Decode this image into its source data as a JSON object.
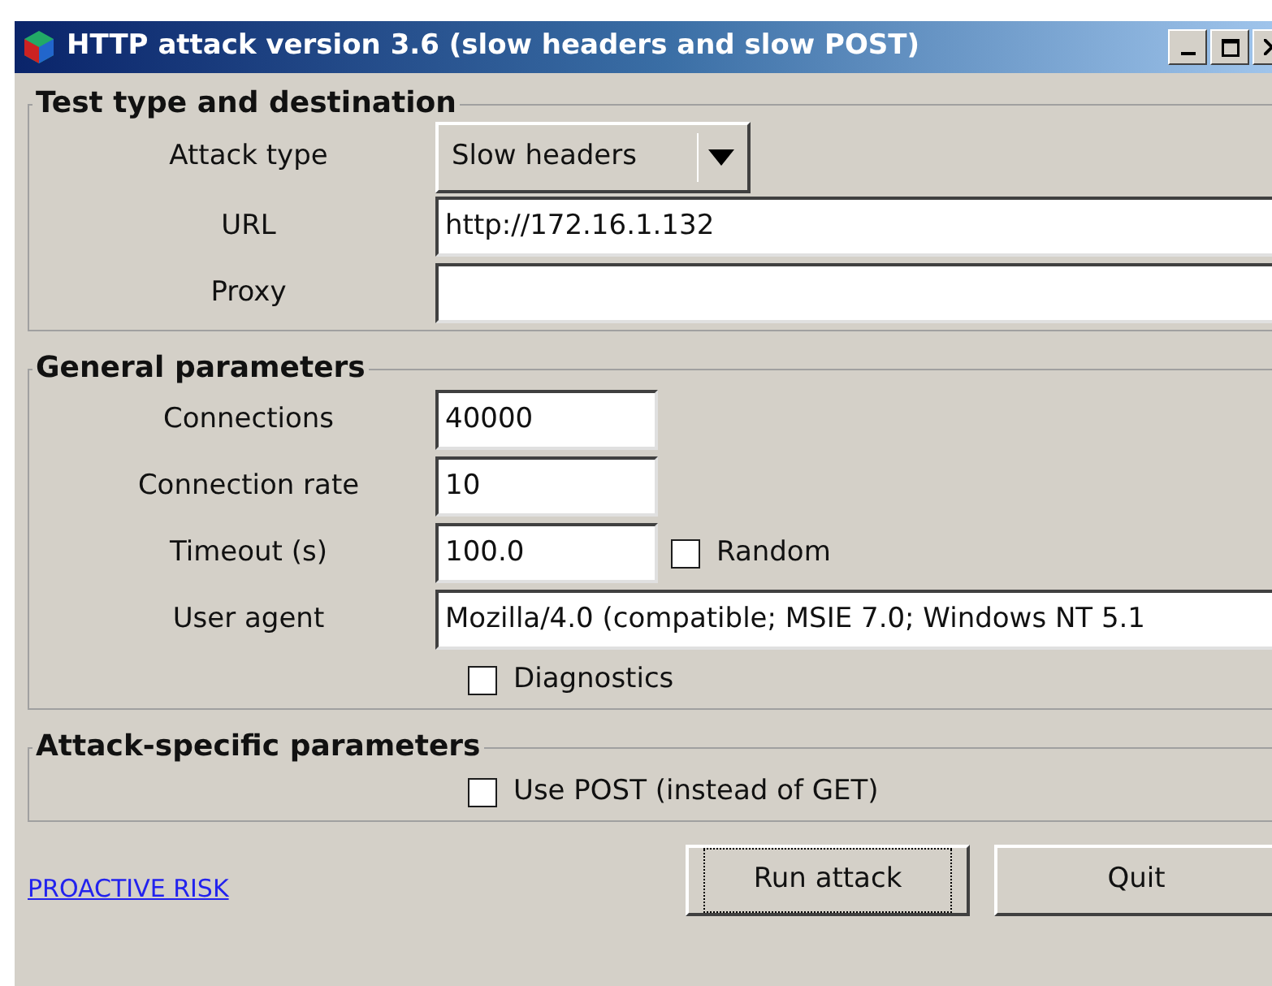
{
  "window": {
    "title": "HTTP attack version 3.6 (slow headers and slow POST)"
  },
  "groups": [
    {
      "title": "Test type and destination",
      "rows": [
        {
          "kind": "dropdown",
          "label": "Attack type",
          "value": "Slow headers"
        },
        {
          "kind": "field",
          "label": "URL",
          "value": "http://172.16.1.132"
        },
        {
          "kind": "field",
          "label": "Proxy",
          "value": ""
        }
      ]
    },
    {
      "title": "General parameters",
      "rows": [
        {
          "kind": "short_field",
          "label": "Connections",
          "value": "40000"
        },
        {
          "kind": "short_field",
          "label": "Connection rate",
          "value": "10"
        },
        {
          "kind": "short_field",
          "label": "Timeout (s)",
          "value": "100.0",
          "checkbox": {
            "label": "Random",
            "checked": false
          }
        },
        {
          "kind": "field",
          "label": "User agent",
          "value": "Mozilla/4.0 (compatible; MSIE 7.0; Windows NT 5.1"
        },
        {
          "kind": "checkbox",
          "label": "Diagnostics",
          "checked": false
        }
      ]
    },
    {
      "title": "Attack-specific parameters",
      "rows": [
        {
          "kind": "checkbox",
          "label": "Use POST (instead of GET)",
          "checked": false
        }
      ]
    }
  ],
  "link": "PROACTIVE RISK",
  "buttons": [
    {
      "label": "Run attack",
      "focused": true
    },
    {
      "label": "Quit",
      "focused": false
    }
  ]
}
